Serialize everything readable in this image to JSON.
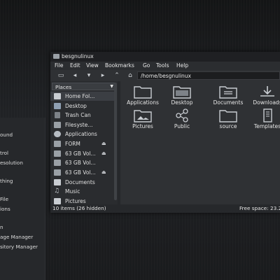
{
  "colors": {
    "accent": "#3b3e43",
    "folder": "#c9cdd2"
  },
  "menu_panel": {
    "items": [
      "ound",
      "trol",
      "esolution",
      "thing",
      "File",
      "ions",
      "n",
      "age Manager",
      "sitory Manager"
    ]
  },
  "window": {
    "title": "besgnulinux",
    "menus": [
      "File",
      "Edit",
      "View",
      "Bookmarks",
      "Go",
      "Tools",
      "Help"
    ],
    "location": "/home/besgnulinux",
    "places_label": "Places",
    "sidebar": [
      {
        "label": "Home Fol...",
        "icon": "home-folder-icon",
        "selected": true
      },
      {
        "label": "Desktop",
        "icon": "desktop-icon"
      },
      {
        "label": "Trash Can",
        "icon": "trash-icon"
      },
      {
        "label": "Filesyste...",
        "icon": "drive-icon"
      },
      {
        "label": "Applications",
        "icon": "applications-icon"
      },
      {
        "label": "FORM",
        "icon": "drive-icon",
        "eject": true
      },
      {
        "label": "63 GB Vol...",
        "icon": "drive-icon",
        "eject": true
      },
      {
        "label": "63 GB Vol...",
        "icon": "drive-icon"
      },
      {
        "label": "63 GB Vol...",
        "icon": "drive-icon",
        "eject": true
      },
      {
        "label": "Documents",
        "icon": "documents-icon"
      },
      {
        "label": "Music",
        "icon": "music-icon"
      },
      {
        "label": "Pictures",
        "icon": "pictures-icon"
      }
    ],
    "files": [
      {
        "label": "Applications",
        "icon": "folder-icon"
      },
      {
        "label": "Desktop",
        "icon": "desktop-folder-icon"
      },
      {
        "label": "Documents",
        "icon": "documents-folder-icon"
      },
      {
        "label": "Downloads",
        "icon": "downloads-folder-icon"
      },
      {
        "label": "Pictures",
        "icon": "pictures-folder-icon"
      },
      {
        "label": "Public",
        "icon": "public-folder-icon"
      },
      {
        "label": "source",
        "icon": "folder-icon"
      },
      {
        "label": "Templates",
        "icon": "templates-folder-icon"
      }
    ],
    "status_left": "10 items (26 hidden)",
    "status_right": "Free space: 23.2"
  }
}
